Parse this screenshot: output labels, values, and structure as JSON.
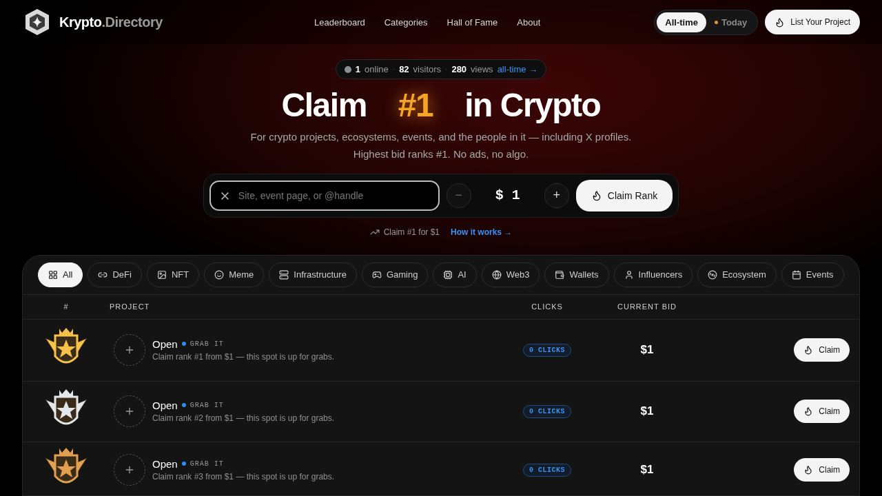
{
  "brand": {
    "name": "Krypto",
    "suffix": ".Directory"
  },
  "nav": [
    "Leaderboard",
    "Categories",
    "Hall of Fame",
    "About"
  ],
  "range_toggle": [
    {
      "label": "All-time",
      "selected": true
    },
    {
      "label": "Today",
      "selected": false
    }
  ],
  "list_button": "List Your Project",
  "stats": {
    "online": "1",
    "online_label": "online",
    "separator_1": "·",
    "visitors": "82",
    "visitors_label": "visitors",
    "separator_2": "·",
    "views": "280",
    "views_label": "views",
    "link": "all-time →"
  },
  "headline": {
    "before": "Claim",
    "highlight": "#1",
    "after": "in Crypto"
  },
  "subtitle": [
    "For crypto projects, ecosystems, events, and the people in it — including X profiles.",
    "Highest bid ranks #1. No ads, no algo."
  ],
  "claim_form": {
    "placeholder": "Site, event page, or @handle",
    "minus": "−",
    "amount": "$ 1",
    "plus": "+",
    "button": "Claim Rank"
  },
  "hint": {
    "text": "Claim #1 for $1",
    "link": "How it works →"
  },
  "categories": [
    {
      "label": "All",
      "selected": true
    },
    {
      "label": "DeFi",
      "selected": false
    },
    {
      "label": "NFT",
      "selected": false
    },
    {
      "label": "Meme",
      "selected": false
    },
    {
      "label": "Infrastructure",
      "selected": false
    },
    {
      "label": "Gaming",
      "selected": false
    },
    {
      "label": "AI",
      "selected": false
    },
    {
      "label": "Web3",
      "selected": false
    },
    {
      "label": "Wallets",
      "selected": false
    },
    {
      "label": "Influencers",
      "selected": false
    },
    {
      "label": "Ecosystem",
      "selected": false
    },
    {
      "label": "Events",
      "selected": false
    }
  ],
  "table": {
    "columns": [
      "#",
      "PROJECT",
      "CLICKS",
      "CURRENT BID"
    ],
    "rows": [
      {
        "color": "#f6c24a",
        "name": "Open",
        "tag": "GRAB IT",
        "description": "Claim rank #1 from $1 — this spot is up for grabs.",
        "clicks": "0 CLICKS",
        "bid": "$1",
        "action": "Claim"
      },
      {
        "color": "#e3e6ea",
        "name": "Open",
        "tag": "GRAB IT",
        "description": "Claim rank #2 from $1 — this spot is up for grabs.",
        "clicks": "0 CLICKS",
        "bid": "$1",
        "action": "Claim"
      },
      {
        "color": "#e0a050",
        "name": "Open",
        "tag": "GRAB IT",
        "description": "Claim rank #3 from $1 — this spot is up for grabs.",
        "clicks": "0 CLICKS",
        "bid": "$1",
        "action": "Claim"
      }
    ]
  }
}
